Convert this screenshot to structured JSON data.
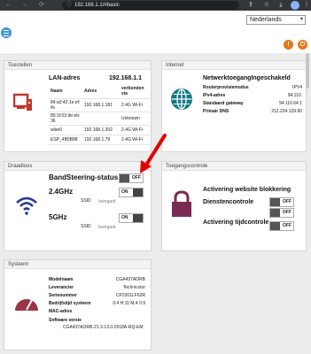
{
  "browser": {
    "back": "←",
    "forward": "→",
    "reload": "⟳",
    "url": "192.168.1.1/#basic",
    "profile_initial": ""
  },
  "header": {
    "language": "Nederlands",
    "btn1": "!",
    "btn2": "⏻"
  },
  "toestellen": {
    "title": "Toestellen",
    "lan_label": "LAN-adres",
    "lan_ip": "192.168.1.1",
    "columns": [
      "Naam",
      "Adres",
      "verbonden via"
    ],
    "rows": [
      [
        "84:a3:42:1e:ef:4c",
        "192.168.1.181",
        "2.4G Wi-Fi"
      ],
      [
        "80:1f:02:de:eb:36",
        "",
        "Unknown"
      ],
      [
        "wlan0",
        "192.168.1.202",
        "2.4G Wi-Fi"
      ],
      [
        "ESP_4B0B88",
        "192.168.1.79",
        "2.4G Wi-Fi"
      ]
    ]
  },
  "internet": {
    "title": "Internet",
    "status": "NetwerktoegangIngeschakeld",
    "rows": [
      {
        "k": "Routerprovisiemodus",
        "v": "IPV4"
      },
      {
        "k": "IPv4-adres",
        "v": "94.110."
      },
      {
        "k": "Standaard gateway",
        "v": "94.110.64.1"
      },
      {
        "k": "Primair DNS",
        "v": "212.224.129.90"
      }
    ]
  },
  "draadloos": {
    "title": "Draadloos",
    "bandsteering": "BandSteering-status",
    "bandsteering_state": "OFF",
    "band24": "2.4GHz",
    "band24_state": "ON",
    "band5": "5GHz",
    "band5_state": "ON",
    "ssid_label": "SSID",
    "ssid24": "Isengard",
    "ssid5": "Isengard"
  },
  "toegangscontrole": {
    "title": "Toegangscontrole",
    "website": "Activering website blokkering",
    "diensten": "Dienstencontrole",
    "tijd": "Activering tijdcontrole",
    "state_off": "OFF"
  },
  "systeem": {
    "title": "Systeem",
    "rows": [
      {
        "k": "Modelnaam",
        "v": "CGA437AORB"
      },
      {
        "k": "Leverancier",
        "v": "Technicolor"
      },
      {
        "k": "Serienummer",
        "v": "CP2301LF62R"
      },
      {
        "k": "Bedrijfstijd systeem",
        "v": "0:4 H:11 M:4 0:9"
      },
      {
        "k": "MAC-adres",
        "v": ""
      }
    ],
    "sw_label": "Software versie",
    "sw_value": "CGA437AORB-21.3-13.0-2018A-RQ-EM"
  },
  "colors": {
    "accent_red": "#c0392b",
    "teal": "#127983",
    "navy": "#2b3e92",
    "purple": "#7b2a52",
    "maroon": "#9a3547",
    "orange": "#e8761a",
    "blue": "#3d95d6"
  }
}
